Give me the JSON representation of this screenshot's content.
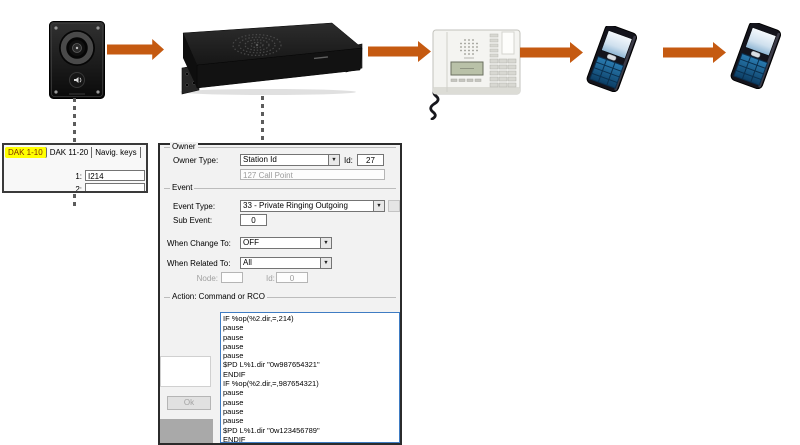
{
  "diagram": {
    "icons": [
      "intercom-station-icon",
      "rack-server-icon",
      "desk-phone-icon",
      "mobile-phone-icon",
      "mobile-phone-icon"
    ],
    "colors": {
      "arrow": "#C55A11",
      "tab_highlight": "#FFFF00",
      "script_border": "#3F7CC3"
    }
  },
  "dak_panel": {
    "tabs": [
      {
        "label": "DAK 1-10",
        "active": true
      },
      {
        "label": "DAK 11-20",
        "active": false
      },
      {
        "label": "Navig. keys",
        "active": false
      }
    ],
    "rows": [
      {
        "label": "1:",
        "value": "I214"
      },
      {
        "label": "2:",
        "value": ""
      }
    ]
  },
  "properties_panel": {
    "owner": {
      "title": "Owner",
      "type_label": "Owner Type:",
      "type_value": "Station Id",
      "id_label": "Id:",
      "id_value": "27",
      "description": "127 Call Point"
    },
    "event": {
      "title": "Event",
      "type_label": "Event Type:",
      "type_value": "33 - Private Ringing Outgoing",
      "sub_label": "Sub Event:",
      "sub_value": "0",
      "change_label": "When Change To:",
      "change_value": "OFF",
      "related_label": "When Related To:",
      "related_value": "All",
      "node_label": "Node:",
      "node_value": "",
      "node_id_label": "Id:",
      "node_id_value": "0"
    },
    "action": {
      "title": "Action: Command or RCO",
      "ok_label": "Ok",
      "script": "IF %op(%2.dir,=,214)\npause\npause\npause\npause\n$PD L%1.dir \"0w987654321\"\nENDIF\nIF %op(%2.dir,=,987654321)\npause\npause\npause\npause\n$PD L%1.dir \"0w123456789\"\nENDIF"
    }
  }
}
